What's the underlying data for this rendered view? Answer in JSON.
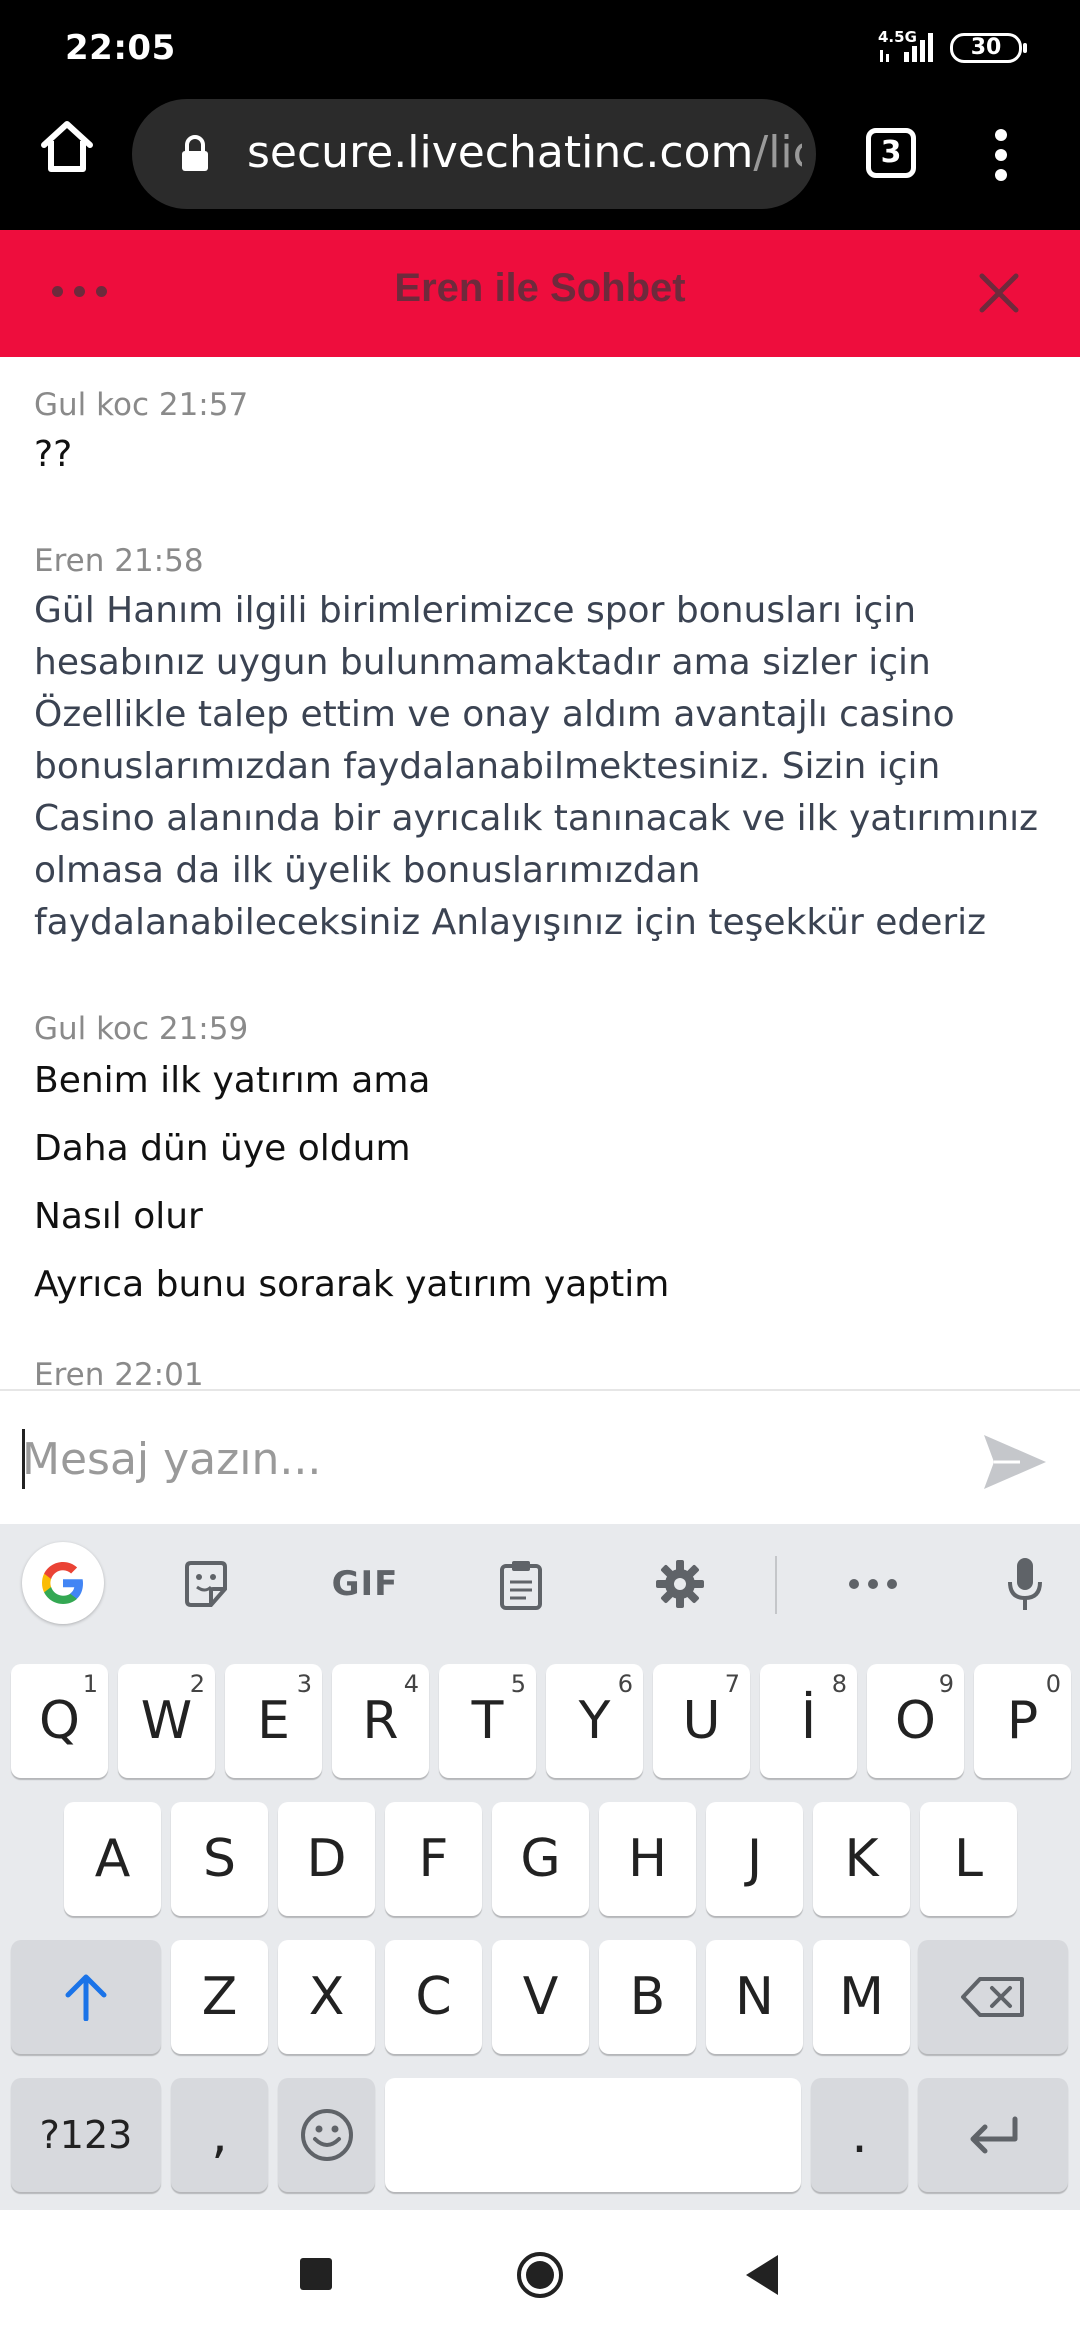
{
  "status_bar": {
    "time": "22:05",
    "network": "4.5G",
    "battery": "30"
  },
  "browser": {
    "url_host": "secure.livechatinc.com",
    "url_rest": "/licen",
    "tab_count": "3"
  },
  "chat": {
    "title": "Eren ile Sohbet",
    "messages": [
      {
        "meta": "Gul koc 21:57",
        "text": "??"
      },
      {
        "meta": "Eren 21:58",
        "text": "Gül Hanım ilgili birimlerimizce spor bonusları için hesabınız uygun bulunmamaktadır ama sizler için Özellikle talep ettim ve onay aldım avantajlı casino bonuslarımızdan faydalanabilmektesiniz. Sizin için Casino alanında bir ayrıcalık tanınacak ve ilk yatırımınız olmasa da ilk üyelik bonuslarımızdan faydalanabileceksiniz Anlayışınız için teşekkür ederiz"
      },
      {
        "meta": "Gul koc 21:59",
        "lines": [
          "Benim ilk yatırım ama",
          "Daha dün üye oldum",
          "Nasıl olur",
          "Ayrıca bunu sorarak yatırım yaptim"
        ]
      },
      {
        "meta": "Eren 22:01"
      }
    ]
  },
  "composer": {
    "placeholder": "Mesaj yazın..."
  },
  "keyboard": {
    "toolbar": {
      "gif": "GIF"
    },
    "row1": [
      {
        "k": "Q",
        "h": "1"
      },
      {
        "k": "W",
        "h": "2"
      },
      {
        "k": "E",
        "h": "3"
      },
      {
        "k": "R",
        "h": "4"
      },
      {
        "k": "T",
        "h": "5"
      },
      {
        "k": "Y",
        "h": "6"
      },
      {
        "k": "U",
        "h": "7"
      },
      {
        "k": "İ",
        "h": "8"
      },
      {
        "k": "O",
        "h": "9"
      },
      {
        "k": "P",
        "h": "0"
      }
    ],
    "row2": [
      "A",
      "S",
      "D",
      "F",
      "G",
      "H",
      "J",
      "K",
      "L"
    ],
    "row3": [
      "Z",
      "X",
      "C",
      "V",
      "B",
      "N",
      "M"
    ],
    "symbols": "?123",
    "comma": ",",
    "period": "."
  }
}
